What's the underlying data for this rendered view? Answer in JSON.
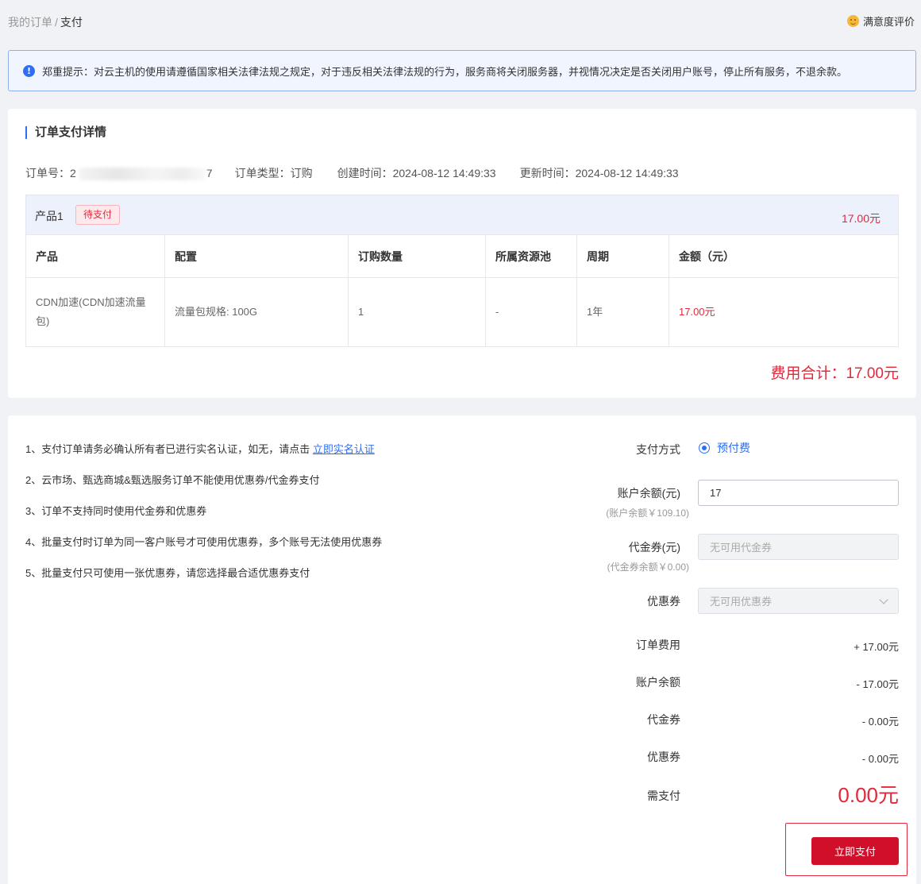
{
  "breadcrumb": {
    "parent": "我的订单",
    "sep": "/",
    "current": "支付"
  },
  "rating_label": "满意度评价",
  "notice": {
    "icon": "info-icon",
    "text": "郑重提示：对云主机的使用请遵循国家相关法律法规之规定，对于违反相关法律法规的行为，服务商将关闭服务器，并视情况决定是否关闭用户账号，停止所有服务，不退余款。"
  },
  "order": {
    "section_title": "订单支付详情",
    "order_no_label": "订单号：",
    "order_no_visible": "2",
    "order_no_tail": "7",
    "type": "订单类型：订购",
    "created": "创建时间：2024-08-12 14:49:33",
    "updated": "更新时间：2024-08-12 14:49:33",
    "product_name": "产品1",
    "status_badge": "待支付",
    "product_price": "17.00元",
    "columns": [
      "产品",
      "配置",
      "订购数量",
      "所属资源池",
      "周期",
      "金额（元）"
    ],
    "rows": [
      {
        "product": "CDN加速(CDN加速流量包)",
        "config": "流量包规格: 100G",
        "qty": "1",
        "pool": "-",
        "period": "1年",
        "amount": "17.00元"
      }
    ],
    "total": "费用合计：17.00元"
  },
  "rules": {
    "r1_text": "1、支付订单请务必确认所有者已进行实名认证，如无，请点击",
    "r1_link": "立即实名认证",
    "r2": "2、云市场、甄选商城&甄选服务订单不能使用优惠券/代金券支付",
    "r3": "3、订单不支持同时使用代金券和优惠券",
    "r4": "4、批量支付时订单为同一客户账号才可使用优惠券，多个账号无法使用优惠券",
    "r5": "5、批量支付只可使用一张优惠券，请您选择最合适优惠券支付"
  },
  "payment": {
    "method_label": "支付方式",
    "method_option": "预付费",
    "balance_label": "账户余额(元)",
    "balance_sub": "(账户余额￥109.10)",
    "balance_value": "17",
    "voucher_label": "代金券(元)",
    "voucher_sub": "(代金券余额￥0.00)",
    "voucher_placeholder": "无可用代金券",
    "coupon_label": "优惠券",
    "coupon_placeholder": "无可用优惠券"
  },
  "summary": {
    "order_fee_label": "订单费用",
    "order_fee": "+ 17.00元",
    "balance_label": "账户余额",
    "balance": "- 17.00元",
    "voucher_label": "代金券",
    "voucher": "- 0.00元",
    "coupon_label": "优惠券",
    "coupon": "- 0.00元",
    "due_label": "需支付",
    "due": "0.00元"
  },
  "pay_button": "立即支付",
  "colors": {
    "accent": "#2f6ef0",
    "danger": "#e0293b",
    "pay_button": "#d0102a"
  }
}
